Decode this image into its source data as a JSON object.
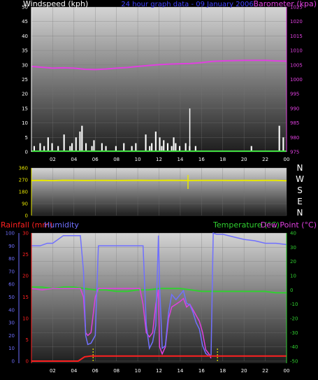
{
  "chart_data": [
    {
      "type": "bar+line",
      "title": "24 hour graph data - 09 January 2006",
      "left_axis_label": "Windspeed (kph)",
      "right_axis_label": "Barometer (kpa)",
      "left_ylim": [
        0,
        50
      ],
      "left_ticks": [
        "0",
        "5",
        "10",
        "15",
        "20",
        "25",
        "30",
        "35",
        "40",
        "45",
        "50"
      ],
      "right_ylim": [
        975,
        1025
      ],
      "right_ticks": [
        "975",
        "980",
        "985",
        "990",
        "995",
        "1000",
        "1005",
        "1010",
        "1015",
        "1020",
        "1025"
      ],
      "x_ticks": [
        "02",
        "04",
        "06",
        "08",
        "10",
        "12",
        "14",
        "16",
        "18",
        "20",
        "22",
        "00"
      ],
      "grid": true,
      "colors": {
        "wind": "#ffffff",
        "barometer": "#e040e0",
        "title": "#4040ff",
        "left_axis": "#ffffff",
        "right_axis": "#e040e0",
        "baseline": "#40e040"
      },
      "series": [
        {
          "name": "Windspeed (kph)",
          "kind": "bars",
          "values": [
            0,
            2,
            0,
            0,
            3,
            0,
            2,
            0,
            5,
            0,
            3,
            0,
            0,
            2,
            0,
            0,
            6,
            0,
            0,
            2,
            3,
            0,
            5,
            0,
            7,
            9,
            0,
            3,
            0,
            0,
            2,
            4,
            0,
            0,
            0,
            3,
            0,
            2,
            0,
            0,
            0,
            0,
            2,
            0,
            0,
            0,
            3,
            0,
            0,
            0,
            2,
            0,
            3,
            0,
            0,
            0,
            0,
            6,
            0,
            2,
            3,
            0,
            7,
            0,
            5,
            2,
            4,
            0,
            3,
            0,
            2,
            5,
            3,
            0,
            2,
            0,
            0,
            3,
            0,
            2,
            0,
            0,
            2,
            0,
            0,
            0,
            0,
            0,
            0,
            0,
            0,
            0,
            0,
            0,
            0,
            0,
            0,
            0,
            0,
            0,
            0,
            0,
            0,
            0,
            0,
            0,
            0,
            0,
            0,
            0,
            2,
            0,
            0,
            0,
            0,
            0,
            0,
            0,
            0,
            0,
            0,
            0,
            0,
            0,
            9,
            0,
            5,
            0
          ]
        },
        {
          "name": "Barometer (kpa)",
          "kind": "line",
          "x": [
            0,
            1,
            2,
            3,
            4,
            5,
            6,
            7,
            8,
            9,
            10,
            11,
            12,
            13,
            14,
            15,
            16,
            17,
            18,
            19,
            20,
            21,
            22,
            23,
            24
          ],
          "values": [
            1004.5,
            1004.2,
            1003.9,
            1004.0,
            1003.9,
            1003.5,
            1003.4,
            1003.6,
            1003.9,
            1004.1,
            1004.5,
            1004.8,
            1005.1,
            1005.3,
            1005.4,
            1005.5,
            1005.8,
            1006.2,
            1006.4,
            1006.5,
            1006.6,
            1006.6,
            1006.6,
            1006.4,
            1006.3
          ]
        }
      ]
    },
    {
      "type": "line",
      "title": "Wind direction",
      "ylim": [
        0,
        360
      ],
      "y_ticks": [
        "0",
        "90",
        "180",
        "270",
        "360"
      ],
      "compass_labels": [
        "N",
        "W",
        "S",
        "E",
        "N"
      ],
      "x_ticks": [],
      "grid": true,
      "colors": {
        "direction": "#e8e800",
        "axis": "#e8e800"
      },
      "series": [
        {
          "name": "Direction",
          "x": [
            0,
            1,
            2,
            3,
            4,
            5,
            6,
            7,
            8,
            9,
            10,
            11,
            12,
            13,
            14,
            15,
            16,
            17,
            18,
            19,
            20,
            21,
            22,
            23,
            24
          ],
          "values": [
            265,
            266,
            264,
            267,
            266,
            265,
            266,
            266,
            265,
            266,
            267,
            266,
            266,
            267,
            266,
            265,
            266,
            266,
            266,
            265,
            266,
            265,
            266,
            266,
            263
          ]
        }
      ]
    },
    {
      "type": "line",
      "left_axis_label_1": "Rainfall (mm)",
      "left_axis_label_2": "Humidity",
      "right_axis_label_1": "Temperature (°C)",
      "right_axis_label_2": "Dew Point (°C)",
      "rain_ylim": [
        0,
        30
      ],
      "rain_ticks": [
        "0",
        "5",
        "10",
        "15",
        "20",
        "25",
        "30"
      ],
      "humidity_ylim": [
        0,
        100
      ],
      "humidity_ticks": [
        "0",
        "10",
        "20",
        "30",
        "40",
        "50",
        "60",
        "70",
        "80",
        "90",
        "100"
      ],
      "temp_ylim": [
        -50,
        40
      ],
      "temp_ticks": [
        "-50",
        "-40",
        "-30",
        "-20",
        "-10",
        "0",
        "10",
        "20",
        "30",
        "40"
      ],
      "x_ticks": [
        "02",
        "04",
        "06",
        "08",
        "10",
        "12",
        "14",
        "16",
        "18",
        "20",
        "22",
        "00"
      ],
      "grid": true,
      "colors": {
        "rain": "#ff2020",
        "humidity": "#7070ff",
        "temperature": "#30d030",
        "dewpoint": "#e040e0",
        "markers": "#e8e800"
      },
      "series": [
        {
          "name": "Humidity",
          "x": [
            0,
            0.8,
            1.5,
            2.0,
            3.0,
            3.8,
            4.6,
            4.9,
            5.1,
            5.3,
            5.6,
            6.0,
            6.3,
            6.6,
            7.5,
            8.5,
            9.5,
            10.2,
            10.5,
            10.8,
            11.1,
            11.4,
            11.7,
            11.95,
            12.05,
            12.3,
            12.6,
            12.9,
            13.2,
            13.6,
            14.0,
            14.3,
            14.6,
            14.9,
            15.2,
            15.5,
            15.8,
            16.1,
            16.4,
            16.7,
            16.9,
            17.1,
            17.4,
            18.0,
            19.0,
            20.0,
            21.0,
            22.0,
            23.0,
            24.0
          ],
          "values": [
            90,
            90,
            92,
            92,
            98,
            98,
            98,
            70,
            20,
            13,
            14,
            20,
            90,
            90,
            90,
            90,
            90,
            90,
            90,
            28,
            10,
            15,
            28,
            98,
            60,
            10,
            12,
            38,
            52,
            48,
            52,
            55,
            45,
            44,
            38,
            30,
            25,
            12,
            6,
            4,
            5,
            100,
            99,
            99,
            97,
            95,
            94,
            92,
            92,
            91
          ]
        },
        {
          "name": "Dew Point (°C)",
          "x": [
            0,
            1.0,
            2.0,
            3.0,
            3.8,
            4.6,
            4.9,
            5.1,
            5.3,
            5.6,
            6.0,
            6.3,
            7.5,
            8.5,
            9.5,
            10.2,
            10.5,
            10.8,
            11.1,
            11.4,
            11.7,
            11.95,
            12.05,
            12.3,
            12.6,
            12.9,
            13.2,
            13.6,
            14.0,
            14.3,
            14.6,
            14.9,
            15.2,
            15.5,
            15.8,
            16.1,
            16.4,
            16.7,
            16.9
          ],
          "values": [
            1,
            0,
            1,
            1,
            1,
            1,
            -5,
            -30,
            -32,
            -30,
            -5,
            1,
            1,
            1,
            1,
            1,
            -10,
            -30,
            -33,
            -30,
            -10,
            0,
            -40,
            -45,
            -40,
            -20,
            -12,
            -10,
            -8,
            -6,
            -12,
            -10,
            -14,
            -18,
            -22,
            -30,
            -42,
            -45,
            -48
          ]
        },
        {
          "name": "Temperature (°C)",
          "x": [
            0,
            1,
            2,
            3,
            4,
            5,
            6,
            7,
            8,
            9,
            10,
            11,
            12,
            13,
            14,
            15,
            16,
            17,
            18,
            19,
            20,
            21,
            22,
            23,
            24
          ],
          "values": [
            2,
            2,
            1,
            2,
            2,
            1,
            0,
            0,
            -1,
            -1,
            0,
            0,
            1,
            1,
            1,
            0,
            -1,
            -1,
            -1,
            -1,
            -1,
            -1,
            -1,
            -2,
            -2
          ]
        },
        {
          "name": "Rainfall (mm)",
          "x": [
            0,
            4.4,
            5.0,
            5.6,
            24
          ],
          "values": [
            0,
            0,
            1,
            1.2,
            1.2
          ]
        }
      ],
      "markers_x": [
        5.8,
        17.5
      ]
    }
  ]
}
